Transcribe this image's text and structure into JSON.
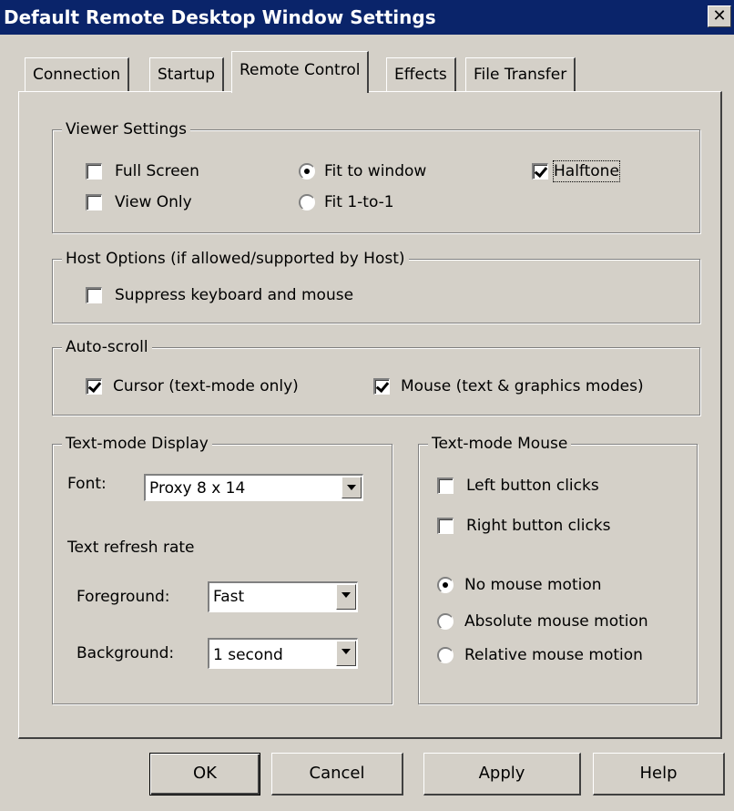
{
  "window": {
    "title": "Default Remote Desktop Window Settings",
    "close": "✕"
  },
  "tabs": [
    {
      "label": "Connection"
    },
    {
      "label": "Startup"
    },
    {
      "label": "Remote Control"
    },
    {
      "label": "Effects"
    },
    {
      "label": "File Transfer"
    }
  ],
  "viewer_settings": {
    "title": "Viewer Settings",
    "full_screen": {
      "label": "Full Screen",
      "checked": false
    },
    "view_only": {
      "label": "View Only",
      "checked": false
    },
    "fit_to_window": {
      "label": "Fit to window",
      "selected": true
    },
    "fit_1to1": {
      "label": "Fit 1-to-1",
      "selected": false
    },
    "halftone": {
      "label": "Halftone",
      "checked": true
    }
  },
  "host_options": {
    "title": "Host Options (if allowed/supported by Host)",
    "suppress": {
      "label": "Suppress keyboard and mouse",
      "checked": false
    }
  },
  "auto_scroll": {
    "title": "Auto-scroll",
    "cursor": {
      "label": "Cursor (text-mode only)",
      "checked": true
    },
    "mouse": {
      "label": "Mouse (text & graphics modes)",
      "checked": true
    }
  },
  "text_display": {
    "title": "Text-mode Display",
    "font_label": "Font:",
    "font_value": "Proxy 8 x 14",
    "refresh_label": "Text refresh rate",
    "foreground_label": "Foreground:",
    "foreground_value": "Fast",
    "background_label": "Background:",
    "background_value": "1 second"
  },
  "text_mouse": {
    "title": "Text-mode Mouse",
    "left_clicks": {
      "label": "Left button clicks",
      "checked": false
    },
    "right_clicks": {
      "label": "Right button clicks",
      "checked": false
    },
    "no_motion": {
      "label": "No mouse motion",
      "selected": true
    },
    "absolute_motion": {
      "label": "Absolute mouse motion",
      "selected": false
    },
    "relative_motion": {
      "label": "Relative mouse motion",
      "selected": false
    }
  },
  "buttons": {
    "ok": "OK",
    "cancel": "Cancel",
    "apply": "Apply",
    "help": "Help"
  }
}
